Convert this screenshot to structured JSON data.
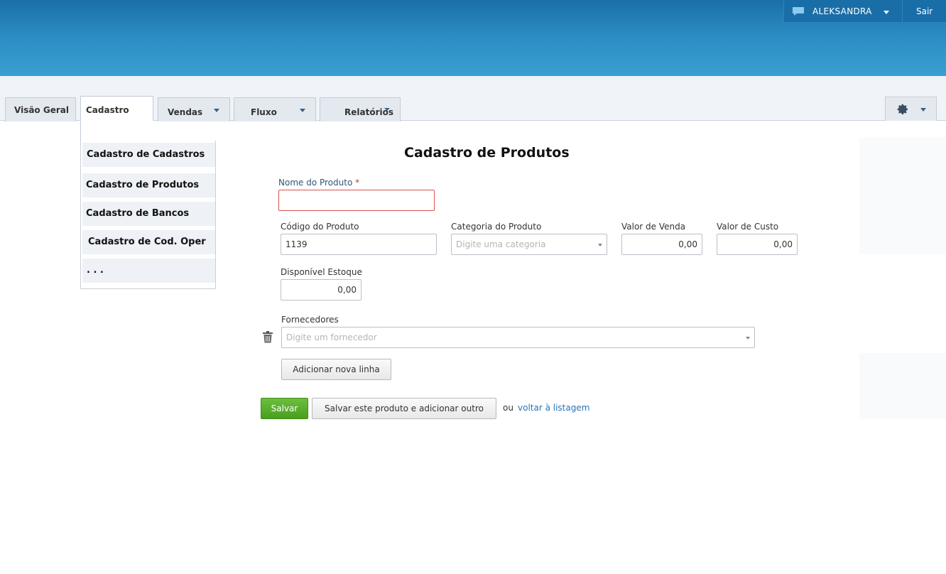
{
  "header": {
    "username": "ALEKSANDRA",
    "logout_label": "Sair"
  },
  "nav": {
    "tabs": [
      {
        "label": "Visão Geral"
      },
      {
        "label": "Cadastro"
      },
      {
        "label": "Vendas"
      },
      {
        "label": "Fluxo"
      },
      {
        "label": "Relatórios"
      }
    ],
    "active_tab": "Cadastro"
  },
  "dropdown": {
    "items": [
      {
        "label": "Cadastro de Cadastros"
      },
      {
        "label": "Cadastro de Produtos"
      },
      {
        "label": "Cadastro de Bancos"
      },
      {
        "label": "Cadastro de Cod. Oper"
      },
      {
        "label": ". . ."
      }
    ]
  },
  "form": {
    "title": "Cadastro de Produtos",
    "product_name": {
      "label": "Nome do Produto",
      "required_mark": "*",
      "value": ""
    },
    "product_code": {
      "label": "Código do Produto",
      "value": "1139"
    },
    "category": {
      "label": "Categoria do Produto",
      "placeholder": "Digite uma categoria"
    },
    "sale_value": {
      "label": "Valor de Venda",
      "value": "0,00"
    },
    "cost_value": {
      "label": "Valor de Custo",
      "value": "0,00"
    },
    "stock": {
      "label": "Disponível Estoque",
      "value": "0,00"
    },
    "suppliers": {
      "label": "Fornecedores",
      "placeholder": "Digite um fornecedor"
    },
    "add_line_label": "Adicionar nova linha",
    "save_label": "Salvar",
    "save_add_label": "Salvar este produto e adicionar outro",
    "or_text": "ou",
    "back_link": "voltar à listagem"
  },
  "colors": {
    "header_blue": "#2a8bc2",
    "save_green": "#4a9e1f",
    "link_blue": "#2a73b5",
    "error_red": "#d9534f"
  }
}
